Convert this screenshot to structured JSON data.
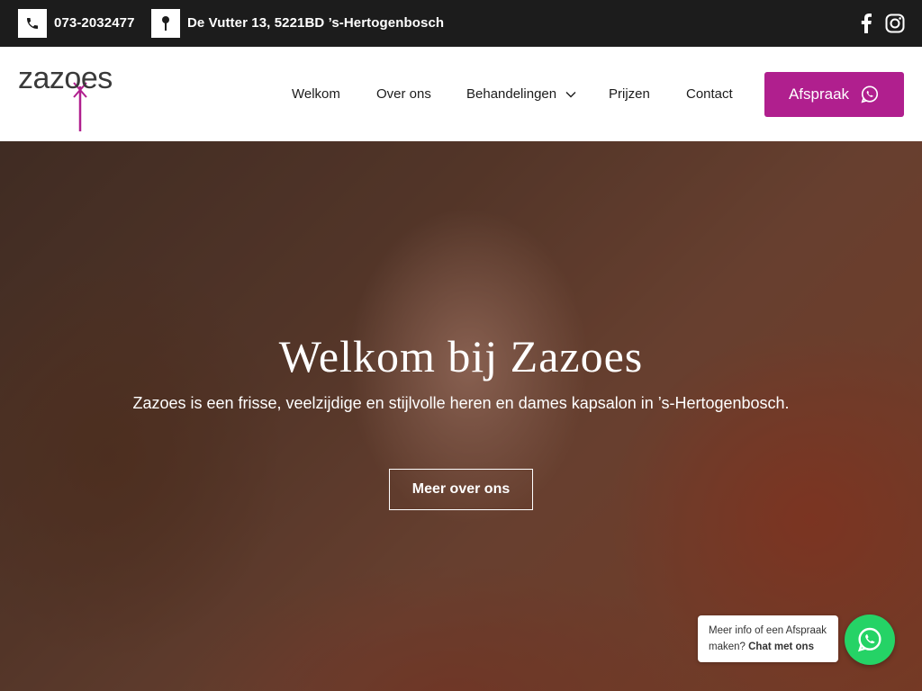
{
  "topbar": {
    "phone": "073-2032477",
    "address": "De Vutter 13, 5221BD ’s-Hertogenbosch",
    "icons": [
      "phone-icon",
      "location-pin-icon",
      "facebook-icon",
      "instagram-icon"
    ]
  },
  "header": {
    "logo_text": "zazoes",
    "nav": [
      {
        "label": "Welkom"
      },
      {
        "label": "Over ons"
      },
      {
        "label": "Behandelingen",
        "has_dropdown": true
      },
      {
        "label": "Prijzen"
      },
      {
        "label": "Contact"
      }
    ],
    "cta_label": "Afspraak"
  },
  "hero": {
    "title": "Welkom bij Zazoes",
    "subtitle": "Zazoes is een frisse, veelzijdige en stijlvolle heren en dames kapsalon in ’s-Hertogenbosch.",
    "button_label": "Meer over ons"
  },
  "chat": {
    "line1": "Meer info of een Afspraak",
    "line2_prefix": "maken?",
    "line2_bold": "Chat met ons"
  },
  "colors": {
    "topbar_bg": "#1c1c1c",
    "brand": "#b01f8e",
    "whatsapp": "#25d366"
  }
}
